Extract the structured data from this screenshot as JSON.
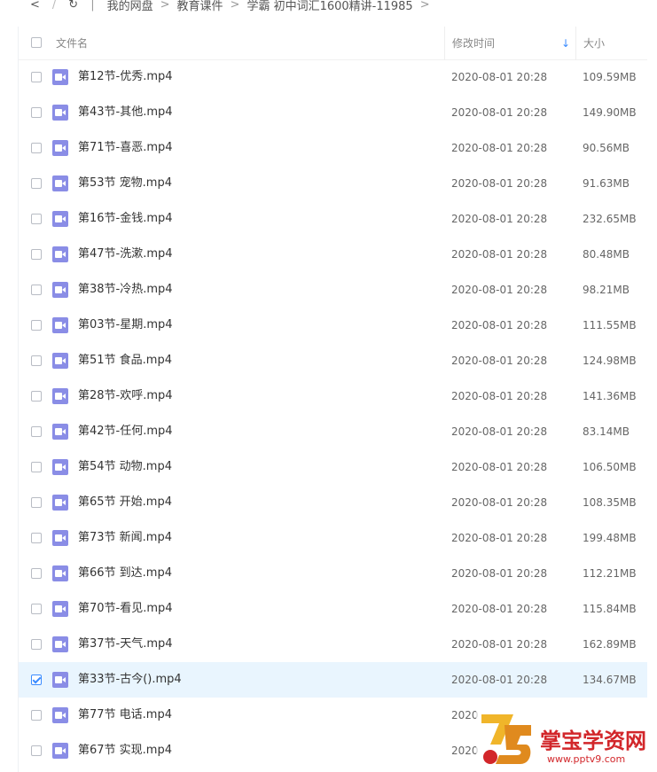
{
  "breadcrumb": {
    "back": "<",
    "forward": "/",
    "path": [
      "我的网盘",
      "教育课件",
      "学霸 初中词汇1600精讲-11985"
    ]
  },
  "header": {
    "col_name": "文件名",
    "col_time": "修改时间",
    "col_size": "大小",
    "sort_indicator": "↓"
  },
  "rows": [
    {
      "name": "第12节-优秀.mp4",
      "time": "2020-08-01 20:28",
      "size": "109.59MB",
      "checked": false
    },
    {
      "name": "第43节-其他.mp4",
      "time": "2020-08-01 20:28",
      "size": "149.90MB",
      "checked": false
    },
    {
      "name": "第71节-喜恶.mp4",
      "time": "2020-08-01 20:28",
      "size": "90.56MB",
      "checked": false
    },
    {
      "name": "第53节 宠物.mp4",
      "time": "2020-08-01 20:28",
      "size": "91.63MB",
      "checked": false
    },
    {
      "name": "第16节-金钱.mp4",
      "time": "2020-08-01 20:28",
      "size": "232.65MB",
      "checked": false
    },
    {
      "name": "第47节-洗漱.mp4",
      "time": "2020-08-01 20:28",
      "size": "80.48MB",
      "checked": false
    },
    {
      "name": "第38节-冷热.mp4",
      "time": "2020-08-01 20:28",
      "size": "98.21MB",
      "checked": false
    },
    {
      "name": "第03节-星期.mp4",
      "time": "2020-08-01 20:28",
      "size": "111.55MB",
      "checked": false
    },
    {
      "name": "第51节 食品.mp4",
      "time": "2020-08-01 20:28",
      "size": "124.98MB",
      "checked": false
    },
    {
      "name": "第28节-欢呼.mp4",
      "time": "2020-08-01 20:28",
      "size": "141.36MB",
      "checked": false
    },
    {
      "name": "第42节-任何.mp4",
      "time": "2020-08-01 20:28",
      "size": "83.14MB",
      "checked": false
    },
    {
      "name": "第54节 动物.mp4",
      "time": "2020-08-01 20:28",
      "size": "106.50MB",
      "checked": false
    },
    {
      "name": "第65节 开始.mp4",
      "time": "2020-08-01 20:28",
      "size": "108.35MB",
      "checked": false
    },
    {
      "name": "第73节 新闻.mp4",
      "time": "2020-08-01 20:28",
      "size": "199.48MB",
      "checked": false
    },
    {
      "name": "第66节 到达.mp4",
      "time": "2020-08-01 20:28",
      "size": "112.21MB",
      "checked": false
    },
    {
      "name": "第70节-看见.mp4",
      "time": "2020-08-01 20:28",
      "size": "115.84MB",
      "checked": false
    },
    {
      "name": "第37节-天气.mp4",
      "time": "2020-08-01 20:28",
      "size": "162.89MB",
      "checked": false
    },
    {
      "name": "第33节-古今().mp4",
      "time": "2020-08-01 20:28",
      "size": "134.67MB",
      "checked": true
    },
    {
      "name": "第77节 电话.mp4",
      "time": "2020",
      "size": "",
      "checked": false
    },
    {
      "name": "第67节 实现.mp4",
      "time": "2020",
      "size": "",
      "checked": false
    }
  ],
  "watermark": {
    "title": "掌宝学资网",
    "url": "www.pptv9.com"
  },
  "colors": {
    "accent": "#3b8cff",
    "file_icon": "#8a8de6",
    "selected_row": "#e9f5fe",
    "watermark": "#d2262a"
  }
}
